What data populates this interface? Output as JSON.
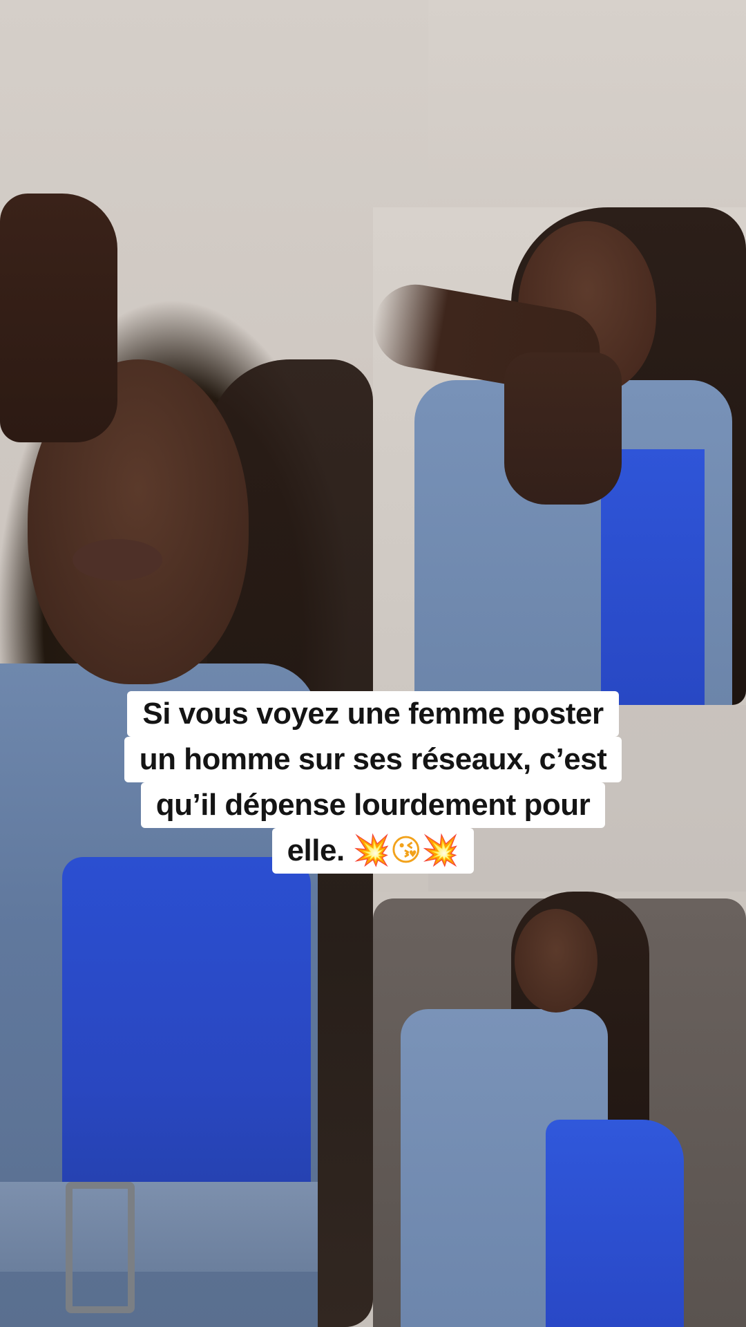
{
  "video": {
    "caption_lines": [
      "Si vous voyez une femme poster",
      "un homme sur ses réseaux, c’est",
      "qu’il dépense lourdement pour",
      "elle."
    ],
    "caption_emojis": [
      "💥",
      "😘",
      "💥"
    ]
  },
  "colors": {
    "caption_background": "#ffffff",
    "caption_text": "#141414",
    "wall": "#cfc9c4",
    "shirt_blue": "#2b4fd1",
    "denim": "#6f88ad"
  }
}
